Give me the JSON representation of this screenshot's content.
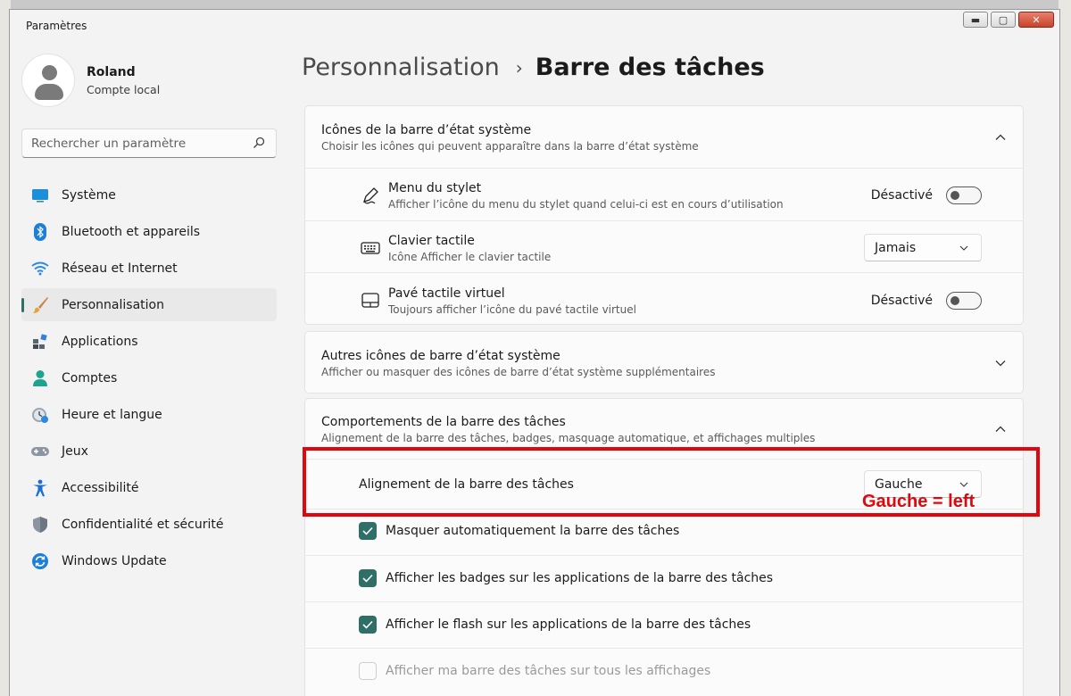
{
  "window": {
    "title": "Paramètres"
  },
  "window_controls": {
    "minimize": "▬",
    "maximize": "▢",
    "close": "✕"
  },
  "profile": {
    "name": "Roland",
    "account_type": "Compte local"
  },
  "search": {
    "placeholder": "Rechercher un paramètre"
  },
  "sidebar": {
    "items": [
      {
        "label": "Système",
        "icon": "monitor-icon",
        "active": false
      },
      {
        "label": "Bluetooth et appareils",
        "icon": "bluetooth-icon",
        "active": false
      },
      {
        "label": "Réseau et Internet",
        "icon": "wifi-icon",
        "active": false
      },
      {
        "label": "Personnalisation",
        "icon": "brush-icon",
        "active": true
      },
      {
        "label": "Applications",
        "icon": "apps-icon",
        "active": false
      },
      {
        "label": "Comptes",
        "icon": "person-icon",
        "active": false
      },
      {
        "label": "Heure et langue",
        "icon": "clock-globe-icon",
        "active": false
      },
      {
        "label": "Jeux",
        "icon": "gamepad-icon",
        "active": false
      },
      {
        "label": "Accessibilité",
        "icon": "accessibility-icon",
        "active": false
      },
      {
        "label": "Confidentialité et sécurité",
        "icon": "shield-icon",
        "active": false
      },
      {
        "label": "Windows Update",
        "icon": "update-icon",
        "active": false
      }
    ]
  },
  "breadcrumb": {
    "parent": "Personnalisation",
    "separator": "›",
    "current": "Barre des tâches"
  },
  "system_tray_icons": {
    "title": "Icônes de la barre d’état système",
    "subtitle": "Choisir les icônes qui peuvent apparaître dans la barre d’état système",
    "expanded": true,
    "rows": [
      {
        "title": "Menu du stylet",
        "subtitle": "Afficher l’icône du menu du stylet quand celui-ci est en cours d’utilisation",
        "icon": "pen-icon",
        "control": "toggle",
        "value": "Désactivé"
      },
      {
        "title": "Clavier tactile",
        "subtitle": "Icône Afficher le clavier tactile",
        "icon": "keyboard-icon",
        "control": "dropdown",
        "value": "Jamais"
      },
      {
        "title": "Pavé tactile virtuel",
        "subtitle": "Toujours afficher l’icône du pavé tactile virtuel",
        "icon": "touchpad-icon",
        "control": "toggle",
        "value": "Désactivé"
      }
    ]
  },
  "other_tray_icons": {
    "title": "Autres icônes de barre d’état système",
    "subtitle": "Afficher ou masquer des icônes de barre d’état système supplémentaires",
    "expanded": false
  },
  "taskbar_behaviors": {
    "title": "Comportements de la barre des tâches",
    "subtitle": "Alignement de la barre des tâches, badges, masquage automatique, et affichages multiples",
    "expanded": true,
    "alignment": {
      "label": "Alignement de la barre des tâches",
      "value": "Gauche"
    },
    "checkboxes": [
      {
        "label": "Masquer automatiquement la barre des tâches",
        "checked": true,
        "enabled": true
      },
      {
        "label": "Afficher les badges sur les applications de la barre des tâches",
        "checked": true,
        "enabled": true
      },
      {
        "label": "Afficher le flash sur les applications de la barre des tâches",
        "checked": true,
        "enabled": true
      },
      {
        "label": "Afficher ma barre des tâches sur tous les affichages",
        "checked": false,
        "enabled": false
      }
    ]
  },
  "annotation": {
    "text": "Gauche = left",
    "color": "#e0070d"
  },
  "colors": {
    "accent": "#2f6f68",
    "background": "#f3f3f3",
    "card": "#fbfbfb"
  }
}
